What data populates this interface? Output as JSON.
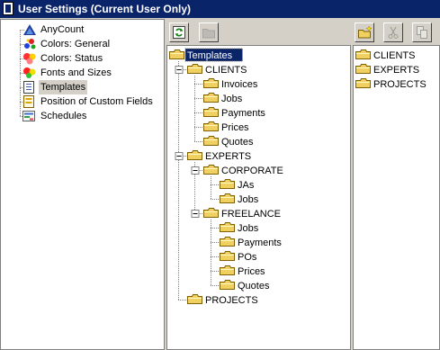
{
  "window": {
    "title": "User Settings (Current User Only)"
  },
  "settings_nav": {
    "items": [
      {
        "label": "AnyCount",
        "icon": "anycount-logo-icon"
      },
      {
        "label": "Colors: General",
        "icon": "color-palette-icon"
      },
      {
        "label": "Colors: Status",
        "icon": "color-status-icon"
      },
      {
        "label": "Fonts and Sizes",
        "icon": "fonts-icon"
      },
      {
        "label": "Templates",
        "icon": "templates-document-icon",
        "selected": true
      },
      {
        "label": "Position of Custom Fields",
        "icon": "custom-fields-icon"
      },
      {
        "label": "Schedules",
        "icon": "schedules-icon"
      }
    ]
  },
  "toolbar_left": {
    "buttons": [
      {
        "icon": "refresh-icon",
        "enabled": true
      },
      {
        "icon": "folder-disabled-icon",
        "enabled": false
      }
    ]
  },
  "toolbar_right": {
    "buttons": [
      {
        "icon": "new-folder-icon",
        "enabled": true
      },
      {
        "icon": "cut-icon",
        "enabled": false
      },
      {
        "icon": "copy-icon",
        "enabled": false
      }
    ]
  },
  "folder_tree": {
    "root": "Templates",
    "clients": {
      "label": "CLIENTS",
      "children": [
        "Invoices",
        "Jobs",
        "Payments",
        "Prices",
        "Quotes"
      ]
    },
    "experts": {
      "label": "EXPERTS",
      "corporate": {
        "label": "CORPORATE",
        "children": [
          "JAs",
          "Jobs"
        ]
      },
      "freelance": {
        "label": "FREELANCE",
        "children": [
          "Jobs",
          "Payments",
          "POs",
          "Prices",
          "Quotes"
        ]
      }
    },
    "projects": {
      "label": "PROJECTS"
    }
  },
  "folder_list": {
    "items": [
      "CLIENTS",
      "EXPERTS",
      "PROJECTS"
    ]
  },
  "colors": {
    "title_bar": "#0a246a",
    "selection": "#0a246a",
    "folder": "#f0d060"
  }
}
